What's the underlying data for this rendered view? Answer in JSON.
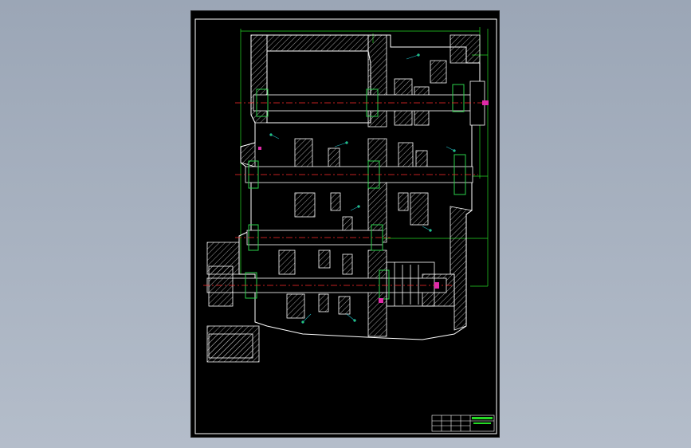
{
  "drawing": {
    "colors": {
      "background": "#000000",
      "frame": "#ffffff",
      "outline": "#ffffff",
      "hatch": "#c8c8c8",
      "centerline": "#ff2a2a",
      "dimension": "#26d926",
      "bearing": "#2ad04a",
      "accent": "#e02aa8",
      "leader": "#22c0c8"
    },
    "title_block": {
      "rows": 3,
      "columns": 6
    }
  }
}
